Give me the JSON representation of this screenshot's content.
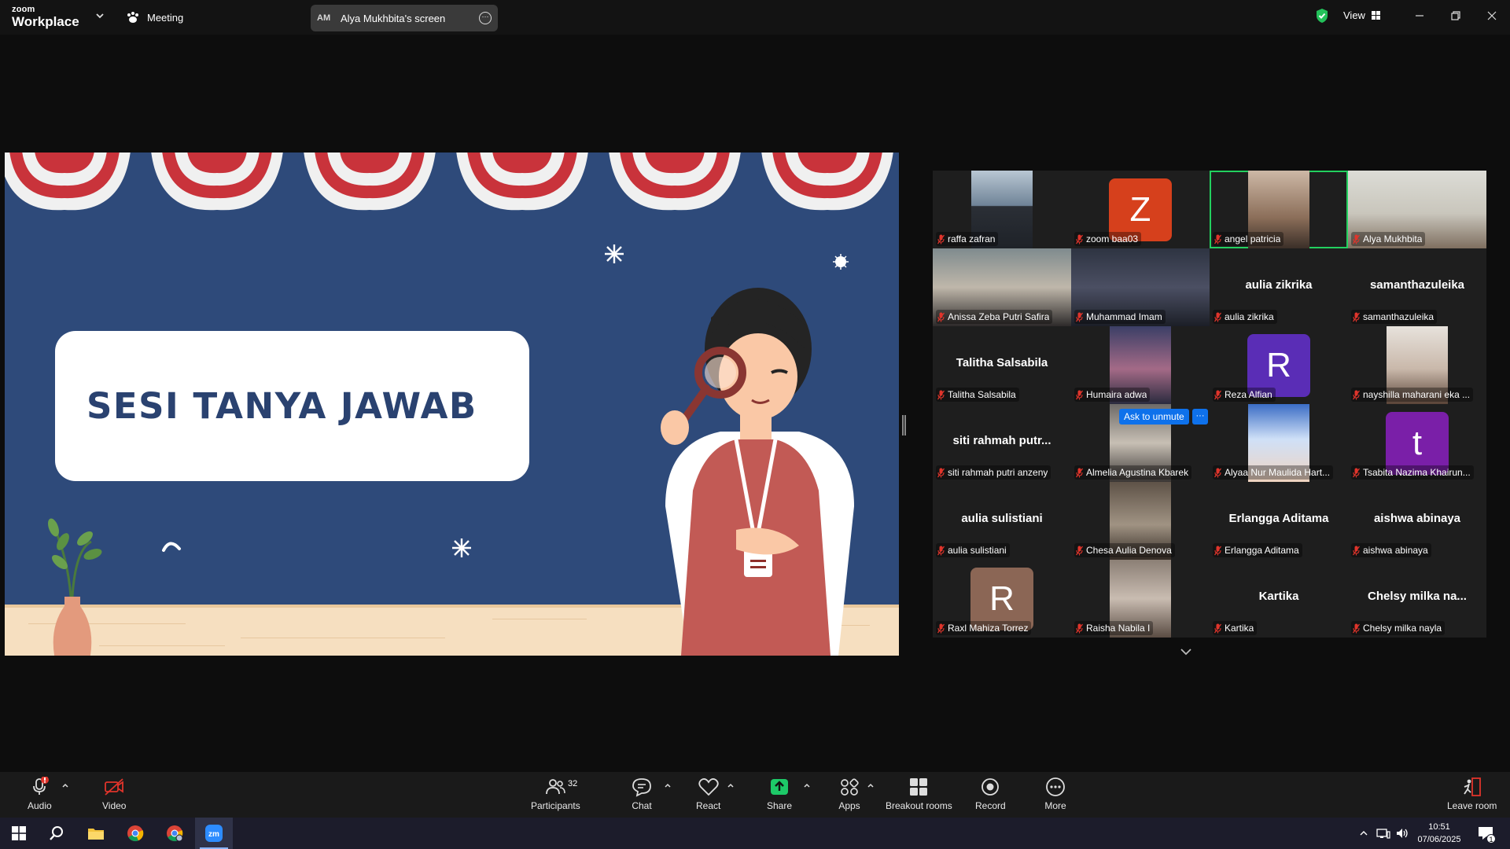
{
  "topbar": {
    "logo_line1": "zoom",
    "logo_line2": "Workplace",
    "meeting_label": "Meeting",
    "share_initials": "AM",
    "share_label": "Alya Mukhbita's screen",
    "view_label": "View"
  },
  "slide": {
    "title": "SESI TANYA JAWAB"
  },
  "gallery": {
    "ask_to_unmute": "Ask to unmute",
    "ask_more": "···",
    "tiles": [
      {
        "name": "raffa zafran",
        "kind": "video"
      },
      {
        "name": "zoom baa03",
        "kind": "avatar",
        "letter": "Z",
        "color": "#d6401c"
      },
      {
        "name": "angel patricia",
        "kind": "video",
        "active": true
      },
      {
        "name": "Alya Mukhbita",
        "kind": "video"
      },
      {
        "name": "Anissa Zeba Putri Safira",
        "kind": "video"
      },
      {
        "name": "Muhammad Imam",
        "kind": "video"
      },
      {
        "name": "aulia zikrika",
        "kind": "name",
        "display": "aulia zikrika"
      },
      {
        "name": "samanthazuleika",
        "kind": "name",
        "display": "samanthazuleika"
      },
      {
        "name": "Talitha Salsabila",
        "kind": "name",
        "display": "Talitha Salsabila"
      },
      {
        "name": "Humaira adwa",
        "kind": "video"
      },
      {
        "name": "Reza Alfian",
        "kind": "avatar",
        "letter": "R",
        "color": "#5a2db6"
      },
      {
        "name": "nayshilla maharani eka ...",
        "kind": "video"
      },
      {
        "name": "siti rahmah putri anzeny",
        "kind": "name",
        "display": "siti  rahmah  putr..."
      },
      {
        "name": "Almelia Agustina Kbarek",
        "kind": "video"
      },
      {
        "name": "Alyaa Nur Maulida Hart...",
        "kind": "video"
      },
      {
        "name": "Tsabita Nazima Khairun...",
        "kind": "avatar",
        "letter": "t",
        "color": "#7a1fa8"
      },
      {
        "name": "aulia sulistiani",
        "kind": "name",
        "display": "aulia sulistiani"
      },
      {
        "name": "Chesa Aulia Denova",
        "kind": "video"
      },
      {
        "name": "Erlangga Aditama",
        "kind": "name",
        "display": "Erlangga Aditama"
      },
      {
        "name": "aishwa abinaya",
        "kind": "name",
        "display": "aishwa abinaya"
      },
      {
        "name": "Raxl Mahiza Torrez",
        "kind": "avatar",
        "letter": "R",
        "color": "#8b6655"
      },
      {
        "name": "Raisha Nabila I",
        "kind": "video"
      },
      {
        "name": "Kartika",
        "kind": "name",
        "display": "Kartika"
      },
      {
        "name": "Chelsy milka nayla",
        "kind": "name",
        "display": "Chelsy  milka  na..."
      }
    ]
  },
  "toolbar": {
    "audio": "Audio",
    "video": "Video",
    "participants": "Participants",
    "participants_count": "32",
    "chat": "Chat",
    "react": "React",
    "share": "Share",
    "apps": "Apps",
    "breakout": "Breakout rooms",
    "record": "Record",
    "more": "More",
    "leave": "Leave room"
  },
  "taskbar": {
    "time": "10:51",
    "date": "07/06/2025",
    "notification_count": "1"
  },
  "colors": {
    "accent_green": "#23d05f",
    "share_green": "#1dc968",
    "zoom_blue": "#0e71eb",
    "mute_red": "#e0342b"
  }
}
